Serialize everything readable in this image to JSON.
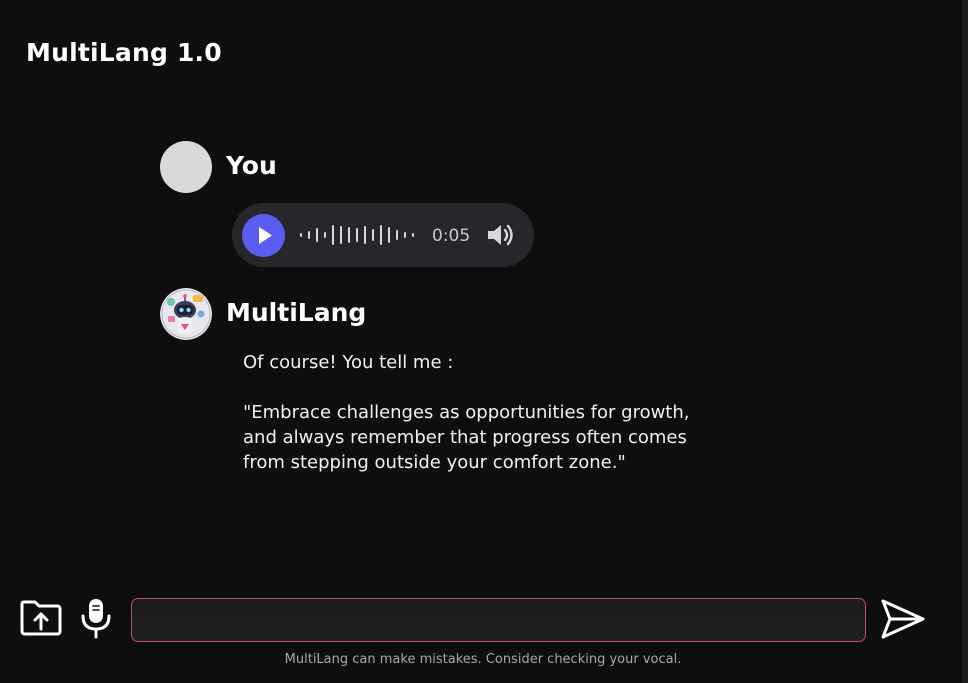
{
  "app": {
    "title": "MultiLang 1.0"
  },
  "conversation": {
    "user_message": {
      "author": "You",
      "avatar": "grey-circle",
      "audio": {
        "duration": "0:05",
        "play_icon": "play-icon",
        "volume_icon": "volume-icon",
        "accent_color": "#5a5ef0"
      }
    },
    "bot_message": {
      "author": "MultiLang",
      "avatar": "robot-avatar-icon",
      "text": "Of course! You tell me :\n\n\"Embrace challenges as opportunities for growth,\nand always remember that progress often comes\nfrom stepping outside your comfort zone.\""
    }
  },
  "composer": {
    "upload_icon": "folder-upload-icon",
    "mic_icon": "microphone-icon",
    "input_value": "",
    "input_placeholder": "",
    "send_icon": "send-icon",
    "border_color": "#c2505d"
  },
  "footer": {
    "disclaimer": "MultiLang can make mistakes. Consider checking your vocal."
  }
}
